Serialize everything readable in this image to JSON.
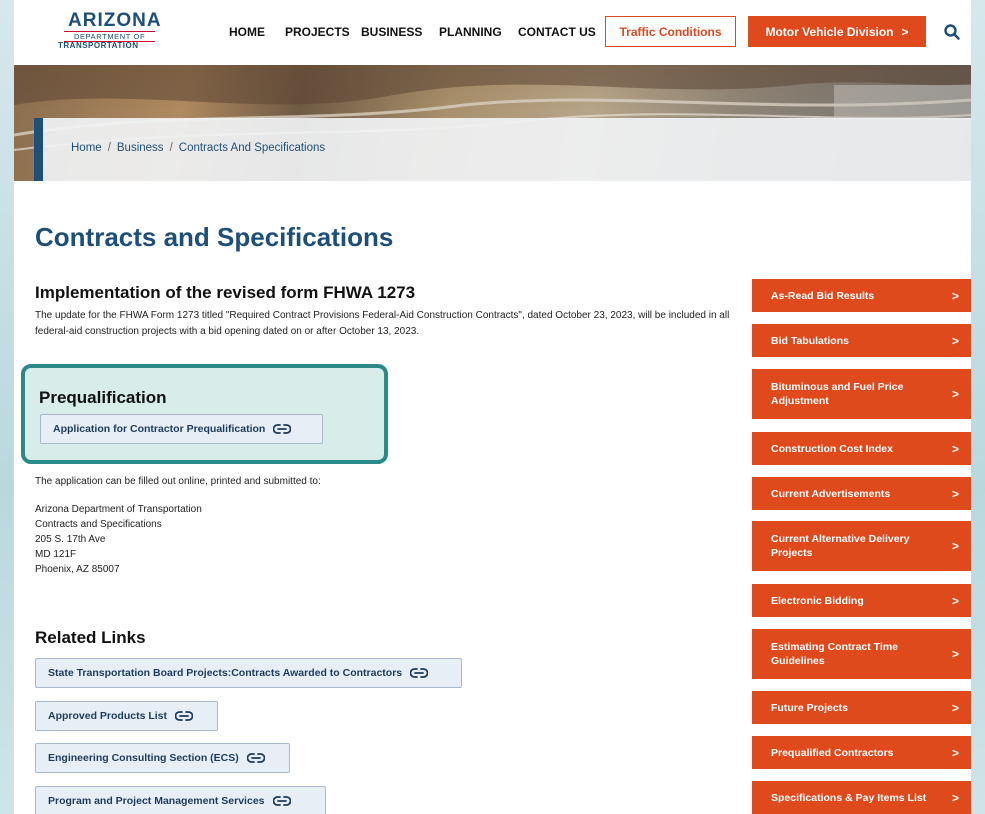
{
  "header": {
    "logo": {
      "main": "ARIZONA",
      "line1": "DEPARTMENT OF",
      "line2": "TRANSPORTATION"
    },
    "nav": [
      "HOME",
      "PROJECTS",
      "BUSINESS",
      "PLANNING",
      "CONTACT US"
    ],
    "traffic_button": "Traffic Conditions",
    "mvd_button": "Motor Vehicle Division",
    "mvd_arrow": ">"
  },
  "breadcrumb": {
    "items": [
      "Home",
      "Business",
      "Contracts And Specifications"
    ],
    "separator": "/"
  },
  "page_title": "Contracts and Specifications",
  "fhwa": {
    "heading": "Implementation of the revised form FHWA 1273",
    "text": "The update for the FHWA Form 1273 titled \"Required Contract Provisions Federal-Aid Construction Contracts\", dated October 23, 2023, will be included in all federal-aid construction projects with a bid opening dated on or after October 13, 2023."
  },
  "prequalification": {
    "heading": "Prequalification",
    "button": "Application for Contractor Prequalification",
    "intro": "The application can be filled out online, printed and submitted to:",
    "address": [
      "Arizona Department of Transportation",
      "Contracts and Specifications",
      "205 S. 17th Ave",
      "MD 121F",
      "Phoenix, AZ 85007"
    ]
  },
  "related_links": {
    "heading": "Related Links",
    "items": [
      "State Transportation Board Projects:Contracts Awarded to Contractors",
      "Approved Products List",
      "Engineering Consulting Section (ECS)",
      "Program and Project Management Services"
    ]
  },
  "sidebar": {
    "chevron": ">",
    "items": [
      [
        "As-Read Bid Results"
      ],
      [
        "Bid Tabulations"
      ],
      [
        "Bituminous and Fuel Price",
        "Adjustment"
      ],
      [
        "Construction Cost Index"
      ],
      [
        "Current Advertisements"
      ],
      [
        "Current Alternative Delivery",
        "Projects"
      ],
      [
        "Electronic Bidding"
      ],
      [
        "Estimating Contract Time",
        "Guidelines"
      ],
      [
        "Future Projects"
      ],
      [
        "Prequalified Contractors"
      ],
      [
        "Specifications & Pay Items List"
      ]
    ]
  },
  "colors": {
    "brand_blue": "#1d4f7a",
    "accent_orange": "#df4a1d",
    "highlight_teal": "#2a8a8a"
  }
}
